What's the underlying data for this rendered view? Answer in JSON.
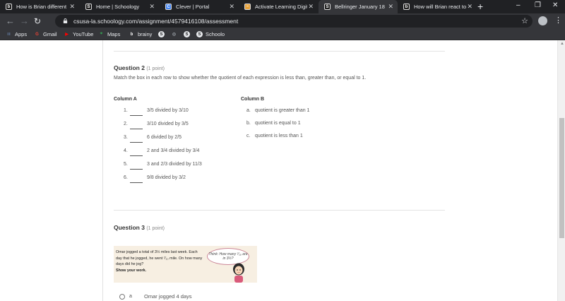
{
  "browser": {
    "tabs": [
      {
        "title": "How is Brian different",
        "icon_color": "#1f1f1f",
        "icon_glyph": "b"
      },
      {
        "title": "Home | Schoology",
        "icon_color": "#1f1f1f",
        "icon_glyph": "S"
      },
      {
        "title": "Clever | Portal",
        "icon_color": "#4285f4",
        "icon_glyph": "C"
      },
      {
        "title": "Activate Learning Digit",
        "icon_color": "#e8a23a",
        "icon_glyph": "~"
      },
      {
        "title": "Bellringer January 18",
        "icon_color": "#1f1f1f",
        "icon_glyph": "S"
      },
      {
        "title": "How will Brian react to",
        "icon_color": "#1f1f1f",
        "icon_glyph": "b"
      }
    ],
    "active_tab_index": 4,
    "new_tab_label": "+",
    "url": "csusa-la.schoology.com/assignment/4579416108/assessment",
    "bookmarks": [
      {
        "label": "Apps",
        "icon": "grid-icon"
      },
      {
        "label": "Gmail",
        "icon": "google-icon"
      },
      {
        "label": "YouTube",
        "icon": "youtube-icon"
      },
      {
        "label": "Maps",
        "icon": "maps-icon"
      },
      {
        "label": "brainy",
        "icon": "brainly-icon"
      },
      {
        "label": "",
        "icon": "schoology-icon"
      },
      {
        "label": "",
        "icon": "globe-icon"
      },
      {
        "label": "",
        "icon": "schoology-icon"
      },
      {
        "label": "Schoolo",
        "icon": "schoology-icon"
      }
    ]
  },
  "question2": {
    "title": "Question 2",
    "points": "(1 point)",
    "prompt": "Match the box in each row to show whether the quotient of each expression is less than, greater than, or equal to 1.",
    "column_a_header": "Column A",
    "column_b_header": "Column B",
    "column_a": [
      {
        "num": "1.",
        "text": "3/5 divided by 3/10"
      },
      {
        "num": "2.",
        "text": "3/10 divided by 3/5"
      },
      {
        "num": "3.",
        "text": "6 divided by 2/5"
      },
      {
        "num": "4.",
        "text": "2 and 3/4 divided by 3/4"
      },
      {
        "num": "5.",
        "text": "3 and 2/3 divided by 11/3"
      },
      {
        "num": "6.",
        "text": "9/8 divided by 3/2"
      }
    ],
    "column_b": [
      {
        "letter": "a.",
        "text": "quotient is greater than 1"
      },
      {
        "letter": "b.",
        "text": "quotient is equal to 1"
      },
      {
        "letter": "c.",
        "text": "quotient is less than 1"
      }
    ]
  },
  "question3": {
    "title": "Question 3",
    "points": "(1 point)",
    "problem_lines": [
      "Omar jogged a total of 3½ miles last week. Each",
      "day that he jogged, he went ⁷⁄₁₀ mile. On how many",
      "days did he jog?"
    ],
    "problem_instruction": "Show your work.",
    "bubble_text": "Think: How many ⁷⁄₁₀ are in 3½?",
    "answers": [
      {
        "letter": "a",
        "text": "Omar jogged 4 days"
      }
    ]
  }
}
